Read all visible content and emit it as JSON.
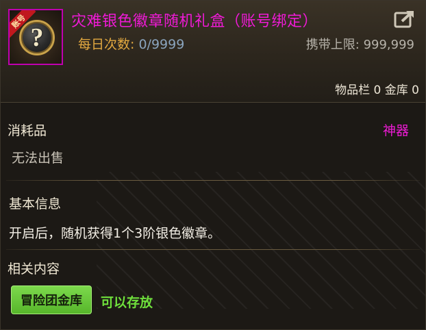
{
  "item": {
    "badge": "账号",
    "icon": "question-mark-icon",
    "title": "灾难银色徽章随机礼盒（账号绑定）",
    "daily_label": "每日次数:",
    "daily_value": "0/9999",
    "limit_label": "携带上限:",
    "limit_value": "999,999",
    "share_icon": "share-icon"
  },
  "storage": {
    "text": "物品栏 0 金库 0"
  },
  "category": {
    "type": "消耗品",
    "tag": "神器",
    "sell_status": "无法出售"
  },
  "basic_info": {
    "heading": "基本信息",
    "description": "开启后，随机获得1个3阶银色徽章。"
  },
  "related": {
    "heading": "相关内容",
    "button_label": "冒险团金库",
    "status": "可以存放"
  },
  "colors": {
    "title": "#ef1ad6",
    "accent_orange": "#e3a940",
    "green": "#6fe03c"
  }
}
